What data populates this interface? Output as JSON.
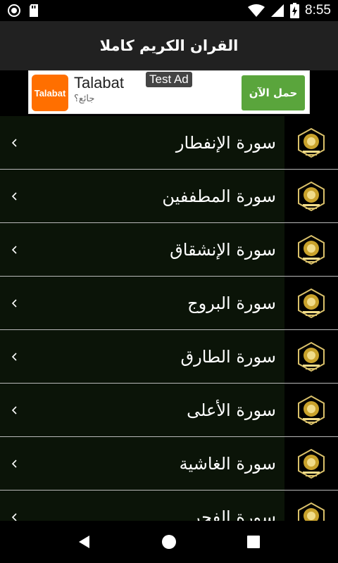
{
  "status_bar": {
    "time": "8:55",
    "icons": [
      "record-icon",
      "sd-card-icon",
      "wifi-icon",
      "signal-icon",
      "battery-charging-icon"
    ],
    "battery_level": "8"
  },
  "app_bar": {
    "title": "القران الكريم كاملا"
  },
  "ad": {
    "logo_text": "Talabat",
    "name": "Talabat",
    "test_label": "Test Ad",
    "subtitle": "جائع؟",
    "cta": "حمل الآن",
    "cta_color": "#5aa53c",
    "logo_color": "#ff6f00"
  },
  "list": {
    "items": [
      {
        "label": "سورة الإنفطار"
      },
      {
        "label": "سورة المطففين"
      },
      {
        "label": "سورة الإنشقاق"
      },
      {
        "label": "سورة البروج"
      },
      {
        "label": "سورة الطارق"
      },
      {
        "label": "سورة الأعلى"
      },
      {
        "label": "سورة الغاشية"
      },
      {
        "label": "سورة الفجر"
      }
    ]
  },
  "nav_bar": {
    "buttons": [
      "back-icon",
      "home-icon",
      "recents-icon"
    ]
  }
}
